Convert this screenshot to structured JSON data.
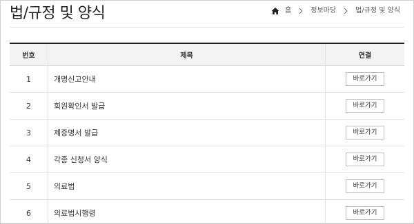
{
  "page": {
    "title": "법/규정 및 양식"
  },
  "breadcrumb": {
    "icon": "home-icon",
    "items": [
      "홈",
      "정보마당",
      "법/규정 및 양식"
    ]
  },
  "table": {
    "headers": {
      "num": "번호",
      "title": "제목",
      "link": "연결"
    },
    "rows": [
      {
        "num": "1",
        "title": "개명신고안내",
        "link": "바로가기"
      },
      {
        "num": "2",
        "title": "회원확인서 발급",
        "link": "바로가기"
      },
      {
        "num": "3",
        "title": "제증명서 발급",
        "link": "바로가기"
      },
      {
        "num": "4",
        "title": "각종 신청서 양식",
        "link": "바로가기"
      },
      {
        "num": "5",
        "title": "의료법",
        "link": "바로가기"
      },
      {
        "num": "6",
        "title": "의료법시행령",
        "link": "바로가기"
      }
    ]
  }
}
